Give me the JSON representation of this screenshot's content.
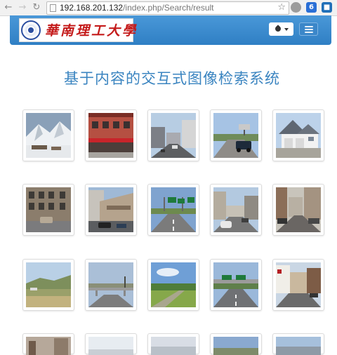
{
  "browser": {
    "url_host": "192.168.201.132",
    "url_path": "/index.php/Search/result"
  },
  "header": {
    "logo_text": "華南理工大學"
  },
  "page": {
    "title": "基于内容的交互式图像检索系统"
  },
  "results": [
    {
      "name": "snow-mountain"
    },
    {
      "name": "brick-storefront"
    },
    {
      "name": "city-street"
    },
    {
      "name": "suv-road"
    },
    {
      "name": "white-house"
    },
    {
      "name": "office-building"
    },
    {
      "name": "building-corner"
    },
    {
      "name": "highway-signs"
    },
    {
      "name": "shopping-street"
    },
    {
      "name": "old-street"
    },
    {
      "name": "hillside-field"
    },
    {
      "name": "highway-bridge"
    },
    {
      "name": "green-valley"
    },
    {
      "name": "highway-overpass"
    },
    {
      "name": "town-street"
    },
    {
      "name": "row4-1"
    },
    {
      "name": "row4-2"
    },
    {
      "name": "row4-3"
    },
    {
      "name": "row4-4"
    },
    {
      "name": "row4-5"
    }
  ]
}
